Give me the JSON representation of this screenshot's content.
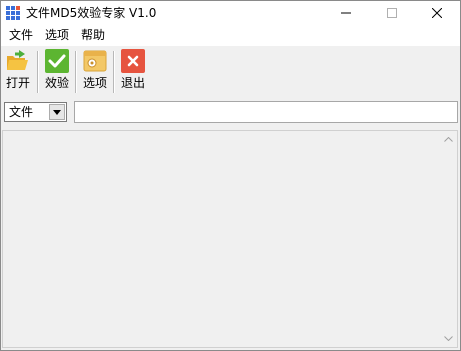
{
  "window": {
    "title": "文件MD5效验专家 V1.0"
  },
  "menu": {
    "items": [
      "文件",
      "选项",
      "帮助"
    ]
  },
  "toolbar": {
    "open_label": "打开",
    "verify_label": "效验",
    "options_label": "选项",
    "exit_label": "退出"
  },
  "input_row": {
    "type_select_value": "文件",
    "path_value": ""
  },
  "colors": {
    "verify_green": "#5cb531",
    "exit_red": "#e6543f",
    "folder_yellow": "#f5c342",
    "options_yellow": "#f3c867"
  },
  "icons": {
    "app": "grid-app-icon",
    "open": "folder-open-icon",
    "verify": "checkmark-icon",
    "options": "settings-window-icon",
    "exit": "close-x-icon"
  }
}
